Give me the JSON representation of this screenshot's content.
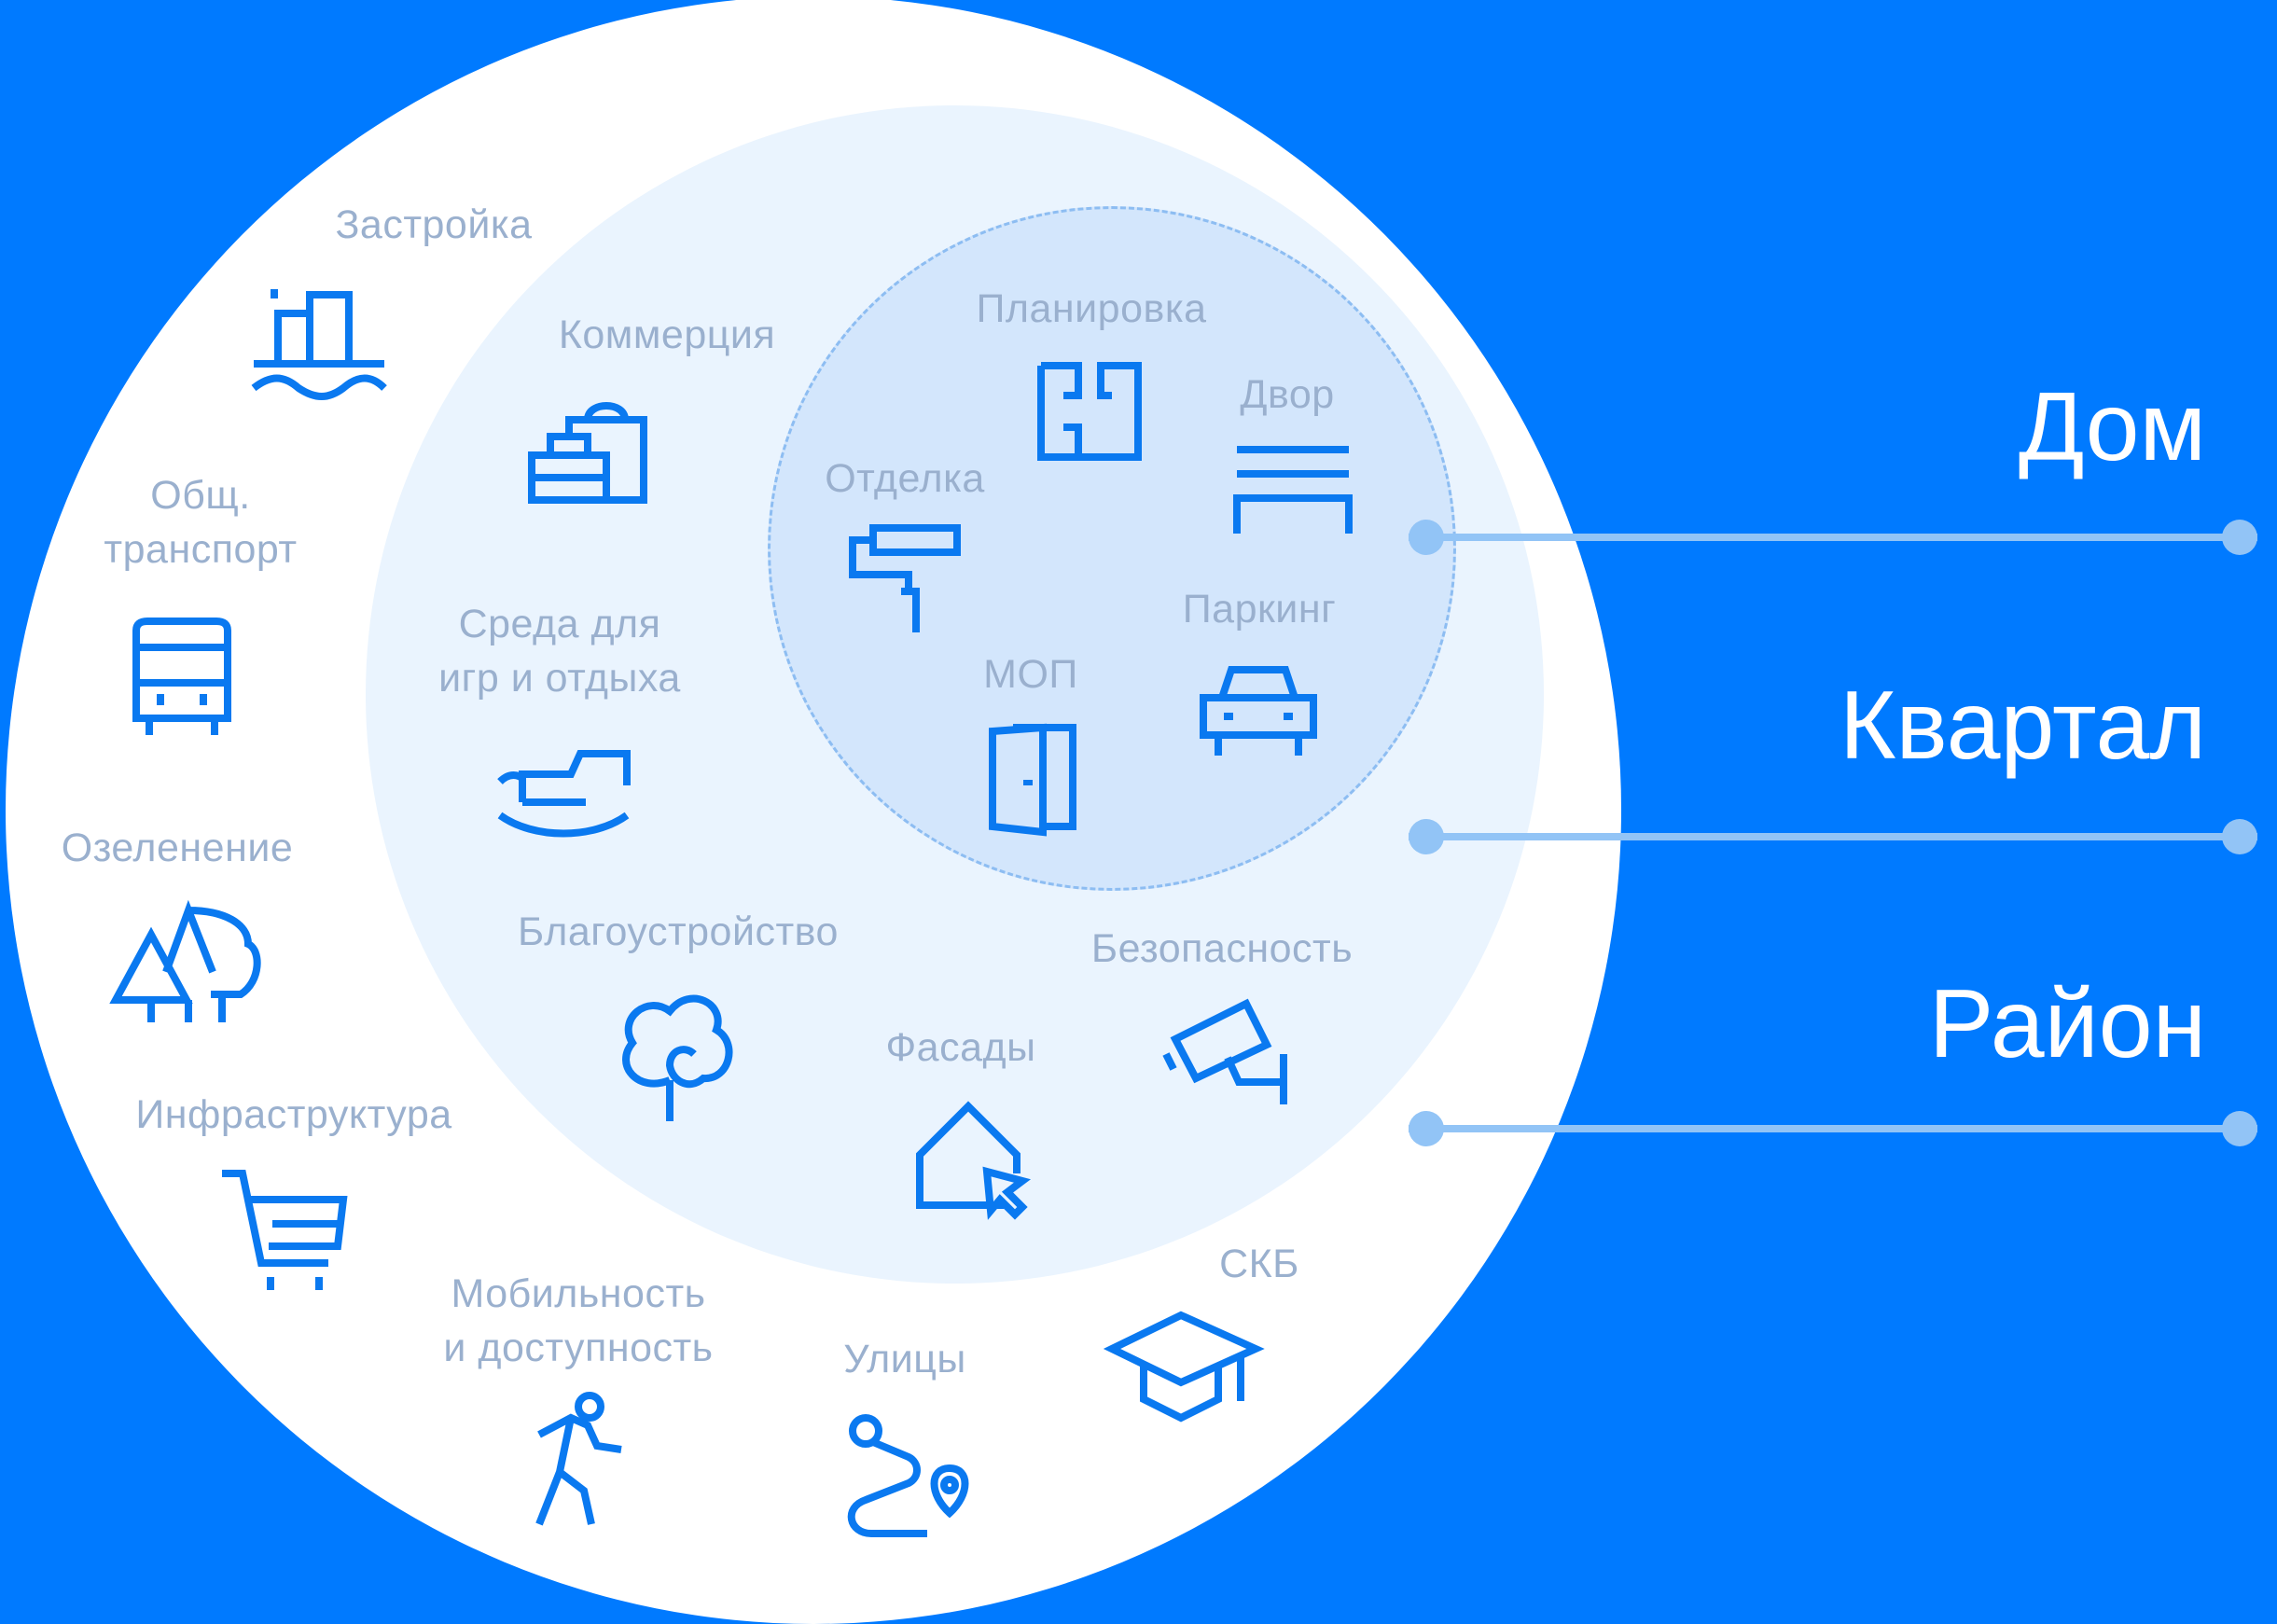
{
  "levels": [
    {
      "label": "Дом"
    },
    {
      "label": "Квартал"
    },
    {
      "label": "Район"
    }
  ],
  "categories": {
    "house": [
      {
        "label": "Планировка",
        "icon": "floor-plan-icon"
      },
      {
        "label": "Двор",
        "icon": "bench-icon"
      },
      {
        "label": "Отделка",
        "icon": "paint-roller-icon"
      },
      {
        "label": "Паркинг",
        "icon": "car-icon"
      },
      {
        "label": "МОП",
        "icon": "door-icon"
      }
    ],
    "block": [
      {
        "label": "Коммерция",
        "icon": "shopping-bags-icon"
      },
      {
        "label": "Среда для\nигр и отдыха",
        "icon": "rocking-horse-icon"
      },
      {
        "label": "Благоустройство",
        "icon": "tree-icon"
      },
      {
        "label": "Фасады",
        "icon": "house-cursor-icon"
      },
      {
        "label": "Безопасность",
        "icon": "security-camera-icon"
      }
    ],
    "district": [
      {
        "label": "Застройка",
        "icon": "buildings-icon"
      },
      {
        "label": "Общ.\nтранспорт",
        "icon": "bus-icon"
      },
      {
        "label": "Озеленение",
        "icon": "forest-icon"
      },
      {
        "label": "Инфраструктура",
        "icon": "shopping-cart-icon"
      },
      {
        "label": "Мобильность\nи доступность",
        "icon": "walking-person-icon"
      },
      {
        "label": "Улицы",
        "icon": "route-icon"
      },
      {
        "label": "СКБ",
        "icon": "graduation-cap-icon"
      }
    ]
  },
  "colors": {
    "background": "#007AFF",
    "outer_circle": "#FFFFFF",
    "middle_circle": "#EAF4FE",
    "inner_circle": "#D3E6FC",
    "icon": "#0A79F0",
    "label": "#9AB0CE",
    "connector": "#92C4F6"
  }
}
